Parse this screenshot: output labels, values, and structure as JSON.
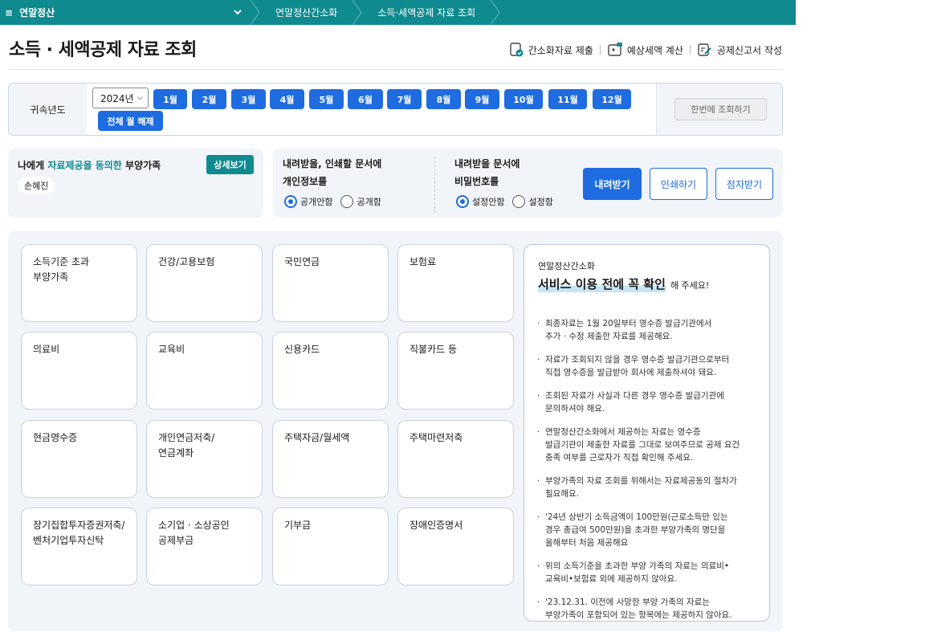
{
  "nav": {
    "menu_icon": "≡",
    "menu_title": "연말정산",
    "breadcrumbs": [
      "연말정산간소화",
      "소득·세액공제 자료 조회"
    ]
  },
  "header": {
    "title": "소득 · 세액공제 자료 조회",
    "actions": [
      "간소화자료 제출",
      "예상세액 계산",
      "공제신고서 작성"
    ]
  },
  "filter": {
    "label": "귀속년도",
    "year": "2024년",
    "months": [
      "1월",
      "2월",
      "3월",
      "4월",
      "5월",
      "6월",
      "7월",
      "8월",
      "9월",
      "10월",
      "11월",
      "12월"
    ],
    "clear_all": "전체 월 해제",
    "query_once": "한번에 조회하기"
  },
  "dependents": {
    "title_prefix": "나에게 ",
    "title_highlight": "자료제공을 동의한",
    "title_suffix": " 부양가족",
    "detail_button": "상세보기",
    "names": [
      "손혜진"
    ]
  },
  "options": {
    "q1_line1": "내려받을, 인쇄할 문서에",
    "q1_line2": "개인정보를",
    "q1_choices": [
      "공개안함",
      "공개함"
    ],
    "q2_line1": "내려받을 문서에",
    "q2_line2": "비밀번호를",
    "q2_choices": [
      "설정안함",
      "설정함"
    ],
    "download": "내려받기",
    "print": "인쇄하기",
    "braille": "점자받기"
  },
  "categories": [
    "소득기준 초과\n부양가족",
    "건강/고용보험",
    "국민연금",
    "보험료",
    "의료비",
    "교육비",
    "신용카드",
    "직불카드 등",
    "현금영수증",
    "개인연금저축/\n연금계좌",
    "주택자금/월세액",
    "주택마련저축",
    "장기집합투자증권저축/\n벤처기업투자신탁",
    "소기업 · 소상공인\n공제부금",
    "기부금",
    "장애인증명서"
  ],
  "notice": {
    "sub": "연말정산간소화",
    "headline": "서비스 이용 전에 꼭 확인",
    "headline_suffix": "해 주세요!",
    "items": [
      "최종자료는 1월 20일부터 영수증 발급기관에서\n추가 · 수정 제출한 자료를 제공해요.",
      "자료가 조회되지 않을 경우 영수증 발급기관으로부터\n직접 영수증을 발급받아 회사에 제출하셔야 돼요.",
      "조회된 자료가 사실과 다른 경우 영수증 발급기관에\n문의하셔야 해요.",
      "연말정산간소화에서 제공하는 자료는 영수증\n발급기관이 제출한 자료를 그대로 보여주므로 공제 요건\n충족 여부를 근로자가 직접 확인해 주세요.",
      "부양가족의 자료 조회를 위해서는 자료제공동의 절차가\n필요해요.",
      "'24년 상반기 소득금액이 100만원(근로소득만 있는\n경우 총급여 500만원)을 초과한 부양가족의 명단을\n올해부터 처음 제공해요",
      "위의 소득기준을 초과한 부양 가족의 자료는 의료비•\n교육비•보험료 외에 제공하지 않아요.",
      "'23.12.31. 이전에 사망한 부양 가족의 자료는\n부양가족이 포함되어 있는 항목에는 제공하지 않아요."
    ]
  },
  "colors": {
    "teal": "#0f8a8f",
    "blue": "#1e6ce0",
    "panel_bg": "#f1f5fa"
  }
}
